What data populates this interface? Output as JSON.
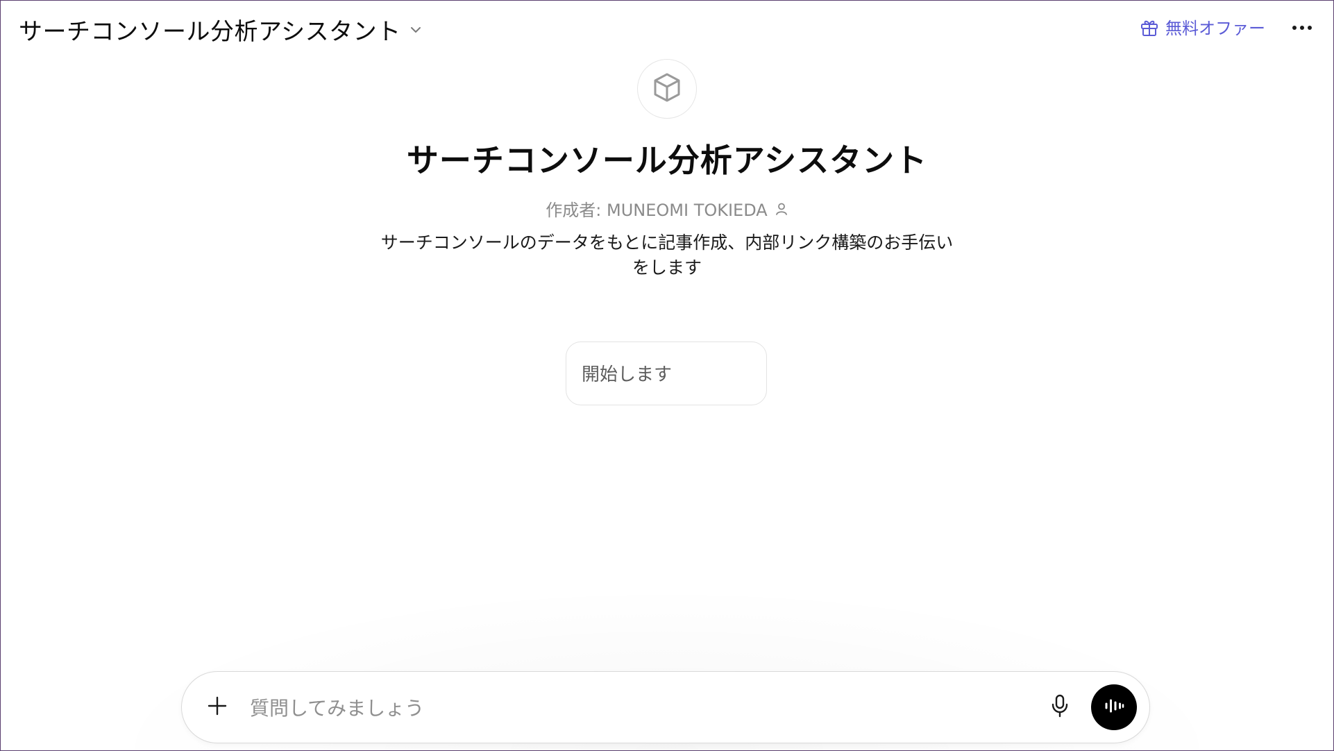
{
  "header": {
    "gpt_switcher_label": "サーチコンソール分析アシスタント",
    "offer_label": "無料オファー",
    "accent_color": "#5b5bd6"
  },
  "hero": {
    "avatar_icon": "cube-icon",
    "gpt_name": "サーチコンソール分析アシスタント",
    "author_line": "作成者: MUNEOMI TOKIEDA",
    "description": "サーチコンソールのデータをもとに記事作成、内部リンク構築のお手伝いをします"
  },
  "conversation_starters": [
    {
      "label": "開始します"
    }
  ],
  "composer": {
    "placeholder": "質問してみましょう",
    "value": ""
  },
  "icons": {
    "switcher": "chevron-down-icon",
    "offer": "gift-icon",
    "more": "more-options-icon",
    "attach": "plus-icon",
    "mic": "microphone-icon",
    "voice": "voice-mode-icon",
    "author": "person-icon"
  }
}
